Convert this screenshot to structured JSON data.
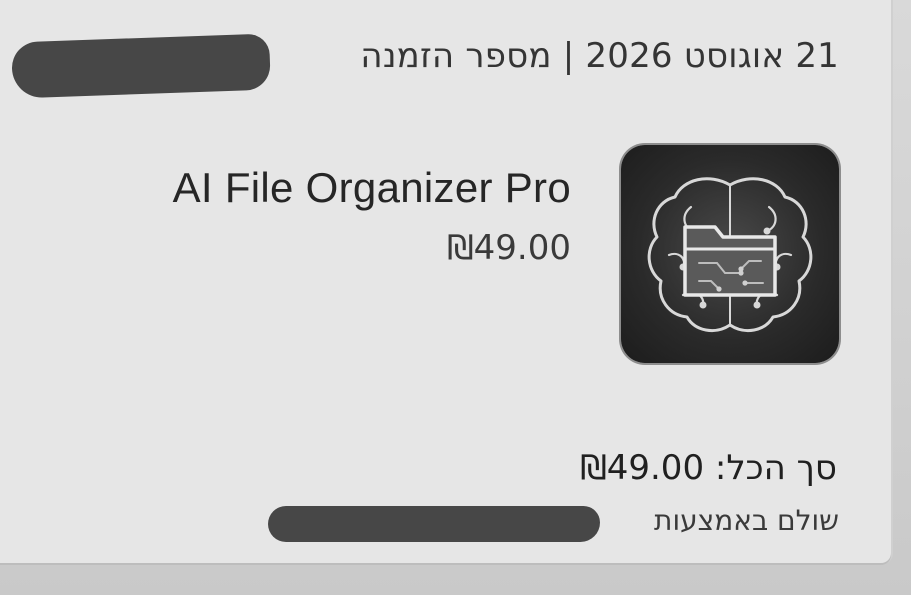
{
  "order": {
    "date": "21 אוגוסט 2026",
    "separator": "|",
    "number_label": "מספר הזמנה"
  },
  "product": {
    "name": "AI File Organizer Pro",
    "price": "₪49.00",
    "icon": "brain-folder-icon"
  },
  "summary": {
    "total_label": "סך הכל:",
    "total_value": "₪49.00",
    "paid_with_label": "שולם באמצעות"
  },
  "colors": {
    "redaction": "#ef1a1a"
  }
}
